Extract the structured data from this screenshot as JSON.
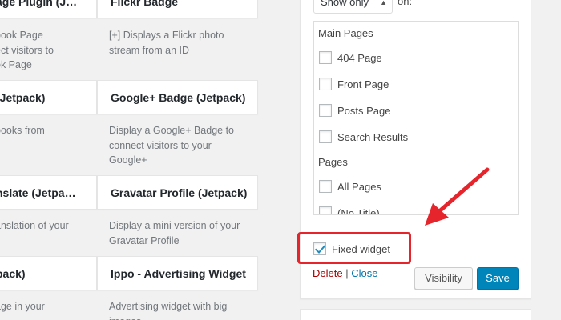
{
  "widgets_left": [
    {
      "title": "age Plugin (J…",
      "desc": "book Page\nect visitors to\nok Page"
    },
    {
      "title": "(Jetpack)",
      "desc": "books from"
    },
    {
      "title": "nslate (Jetpa…",
      "desc": "anslation of your"
    },
    {
      "title": "pack)",
      "desc": "age in your"
    }
  ],
  "widgets_right": [
    {
      "title": "Flickr Badge",
      "desc": "[+] Displays a Flickr photo\nstream from an ID"
    },
    {
      "title": "Google+ Badge (Jetpack)",
      "desc": "Display a Google+ Badge to\nconnect visitors to your\nGoogle+"
    },
    {
      "title": "Gravatar Profile (Jetpack)",
      "desc": "Display a mini version of your\nGravatar Profile"
    },
    {
      "title": "Ippo - Advertising Widget",
      "desc": "Advertising widget with big\nimages"
    }
  ],
  "visibility": {
    "select_value": "Show only",
    "select_suffix": "on:",
    "groups": [
      {
        "label": "Main Pages",
        "items": [
          "404 Page",
          "Front Page",
          "Posts Page",
          "Search Results"
        ]
      },
      {
        "label": "Pages",
        "items": [
          "All Pages",
          "(No Title)"
        ]
      }
    ]
  },
  "fixed_widget": {
    "label": "Fixed widget",
    "checked": true
  },
  "actions": {
    "delete_label": "Delete",
    "separator": "|",
    "close_label": "Close",
    "visibility_label": "Visibility",
    "save_label": "Save"
  },
  "colors": {
    "highlight": "#e5242b",
    "primary": "#0085ba",
    "delete": "#aa0000",
    "link": "#0073aa"
  }
}
